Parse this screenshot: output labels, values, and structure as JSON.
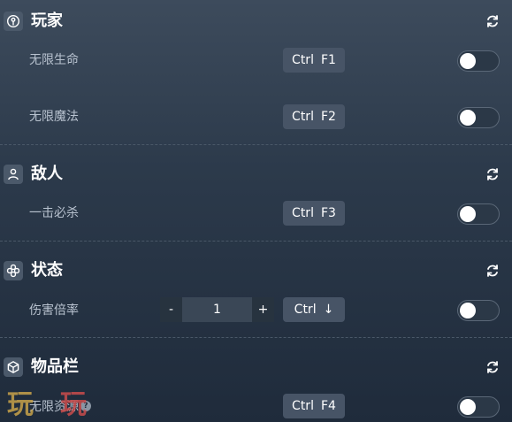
{
  "sections": [
    {
      "title": "玩家",
      "icon": "player-icon",
      "rows": [
        {
          "label": "无限生命",
          "hotkey": {
            "mod": "Ctrl",
            "key": "F1"
          },
          "enabled": false
        },
        {
          "label": "无限魔法",
          "hotkey": {
            "mod": "Ctrl",
            "key": "F2"
          },
          "enabled": false
        }
      ]
    },
    {
      "title": "敌人",
      "icon": "enemy-icon",
      "rows": [
        {
          "label": "一击必杀",
          "hotkey": {
            "mod": "Ctrl",
            "key": "F3"
          },
          "enabled": false
        }
      ]
    },
    {
      "title": "状态",
      "icon": "status-icon",
      "rows": [
        {
          "label": "伤害倍率",
          "stepper": {
            "minus": "-",
            "value": "1",
            "plus": "+"
          },
          "hotkey": {
            "mod": "Ctrl",
            "key": "↓"
          },
          "enabled": false
        }
      ]
    },
    {
      "title": "物品栏",
      "icon": "inventory-icon",
      "rows": [
        {
          "label": "无限资源",
          "hotkey": {
            "mod": "Ctrl",
            "key": "F4"
          },
          "enabled": false
        }
      ]
    }
  ],
  "watermark": {
    "text_a": "玩",
    "text_b": "玩"
  },
  "colors": {
    "background_top": "#3d4b5c",
    "background_bottom": "#1f2b3b",
    "hotkey_bg": "#475466",
    "toggle_off": "#2b3847"
  }
}
